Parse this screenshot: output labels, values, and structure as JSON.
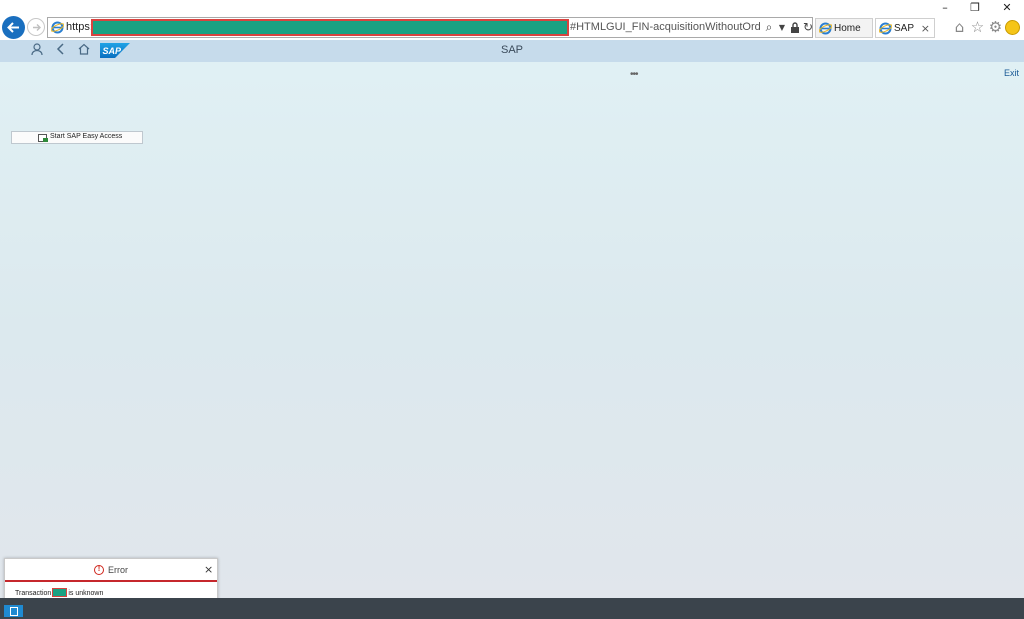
{
  "window_controls": {
    "minimize": "–",
    "maximize": "❐",
    "close": "✕"
  },
  "browser": {
    "url_scheme": "https:/",
    "url_rest": "#HTMLGUI_FIN-acquisitionWithoutOrder?sap-ui-tech",
    "tabs": [
      {
        "label": "Home",
        "active": false
      },
      {
        "label": "SAP",
        "active": true,
        "close": "×"
      }
    ],
    "icons": [
      "back-icon",
      "forward-icon",
      "ie-icon",
      "search-icon",
      "dropdown-icon",
      "lock-icon",
      "refresh-icon",
      "home-icon",
      "favorites-star-icon",
      "settings-gear-icon",
      "feedback-smiley-icon"
    ]
  },
  "shell": {
    "title": "SAP",
    "logo_text": "SAP",
    "overflow": "•••",
    "exit_label": "Exit",
    "accent_color": "#c6dbeb"
  },
  "main": {
    "easy_access_label": "Start SAP Easy Access"
  },
  "error_popup": {
    "title": "Error",
    "message_before": "Transaction",
    "message_after": "is unknown",
    "close": "×",
    "accent_color": "#c6272c"
  }
}
